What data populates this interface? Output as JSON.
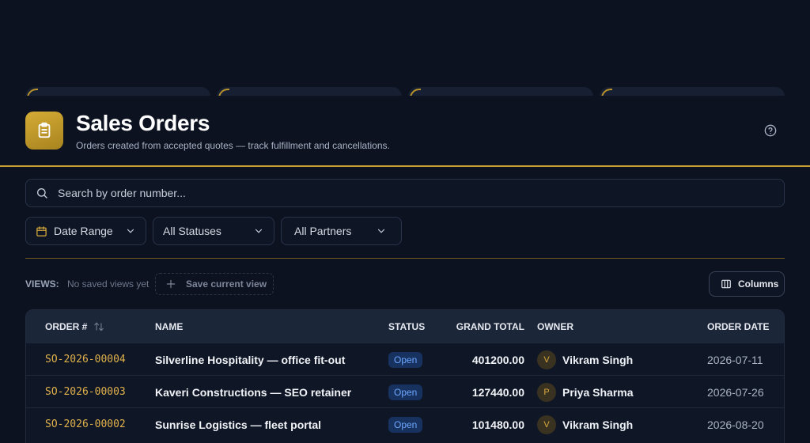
{
  "header": {
    "title": "Sales Orders",
    "subtitle": "Orders created from accepted quotes — track fulfillment and cancellations."
  },
  "search": {
    "placeholder": "Search by order number..."
  },
  "filters": {
    "date_range": "Date Range",
    "status": "All Statuses",
    "partner": "All Partners"
  },
  "views": {
    "label": "VIEWS:",
    "empty_text": "No saved views yet",
    "save_label": "Save current view",
    "columns_label": "Columns"
  },
  "table": {
    "headers": {
      "order": "ORDER #",
      "name": "NAME",
      "status": "STATUS",
      "grand_total": "GRAND TOTAL",
      "owner": "OWNER",
      "order_date": "ORDER DATE"
    },
    "rows": [
      {
        "order": "SO-2026-00004",
        "name": "Silverline Hospitality — office fit-out",
        "status": "Open",
        "grand_total": "401200.00",
        "owner_initial": "V",
        "owner": "Vikram Singh",
        "order_date": "2026-07-11"
      },
      {
        "order": "SO-2026-00003",
        "name": "Kaveri Constructions — SEO retainer",
        "status": "Open",
        "grand_total": "127440.00",
        "owner_initial": "P",
        "owner": "Priya Sharma",
        "order_date": "2026-07-26"
      },
      {
        "order": "SO-2026-00002",
        "name": "Sunrise Logistics — fleet portal",
        "status": "Open",
        "grand_total": "101480.00",
        "owner_initial": "V",
        "owner": "Vikram Singh",
        "order_date": "2026-08-20"
      }
    ]
  },
  "colors": {
    "accent": "#c9a032",
    "background": "#0c1220",
    "badge_open": "#6ea6ff"
  },
  "icons": {
    "app": "clipboard-icon",
    "help": "help-circle-icon",
    "search": "search-icon",
    "calendar": "calendar-icon",
    "chevron": "chevron-down-icon",
    "plus": "plus-icon",
    "columns": "columns-icon",
    "sort": "sort-icon"
  }
}
